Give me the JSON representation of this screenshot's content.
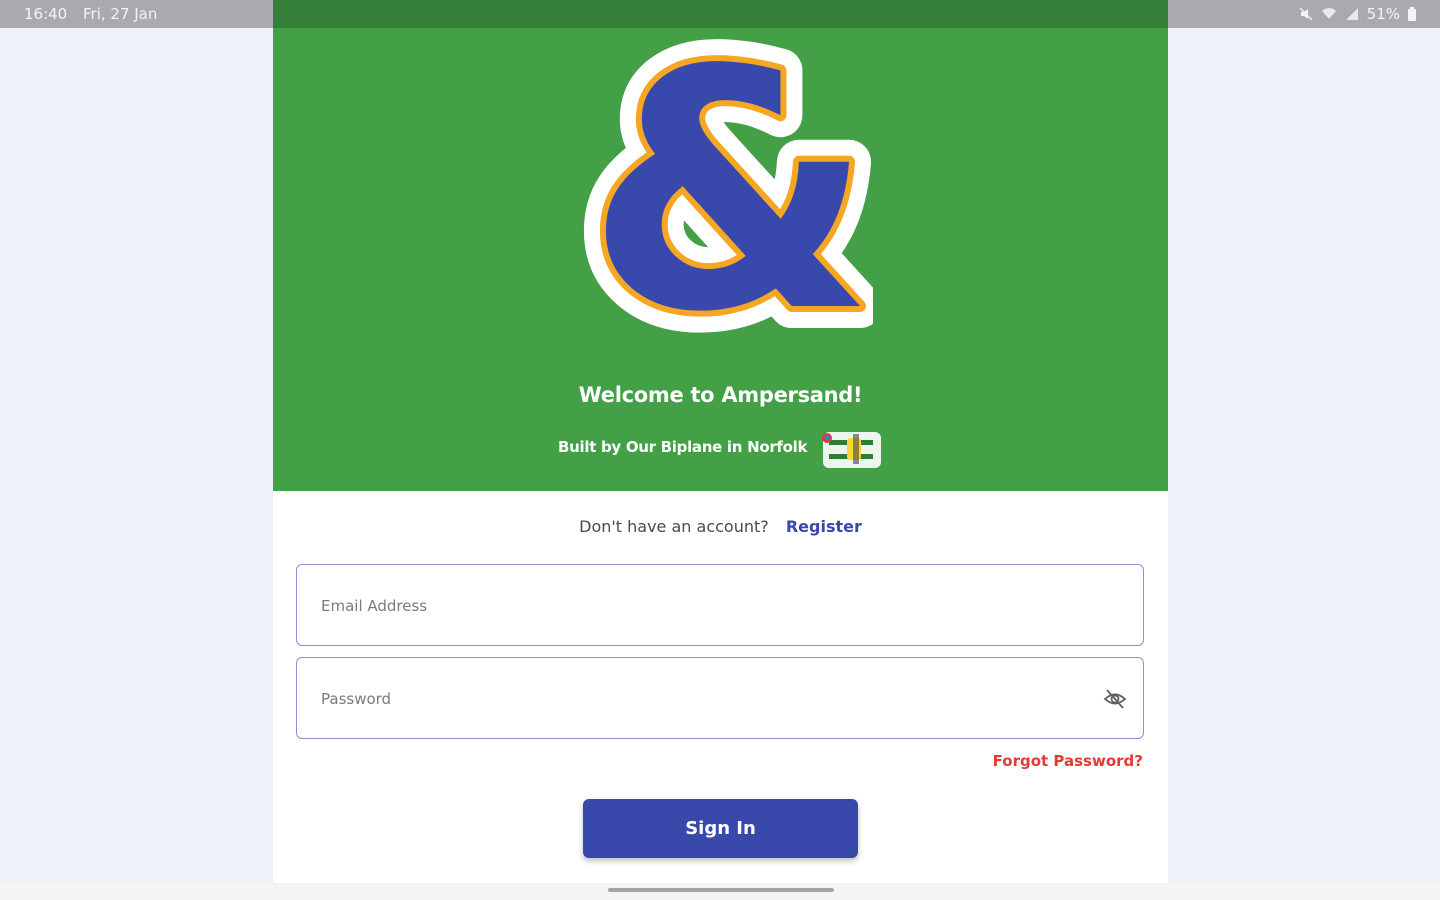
{
  "status_bar": {
    "time": "16:40",
    "date": "Fri, 27 Jan",
    "battery": "51%",
    "icons": [
      "no-sound-icon",
      "wifi-icon",
      "signal-icon",
      "battery-icon"
    ]
  },
  "hero": {
    "title": "Welcome to Ampersand!",
    "built_by": "Built by Our Biplane in Norfolk",
    "logo_icon": "ampersand-logo",
    "badge_icon": "biplane-icon",
    "colors": {
      "background": "#43a047",
      "logo_fill": "#3949ab",
      "logo_outline": "#f5a623"
    }
  },
  "register": {
    "question": "Don't have an account?",
    "link": "Register"
  },
  "form": {
    "email_placeholder": "Email Address",
    "password_placeholder": "Password",
    "toggle_icon": "eye-off-icon",
    "forgot": "Forgot Password?",
    "submit": "Sign In"
  },
  "colors": {
    "primary": "#3949ab",
    "danger": "#e53935"
  }
}
